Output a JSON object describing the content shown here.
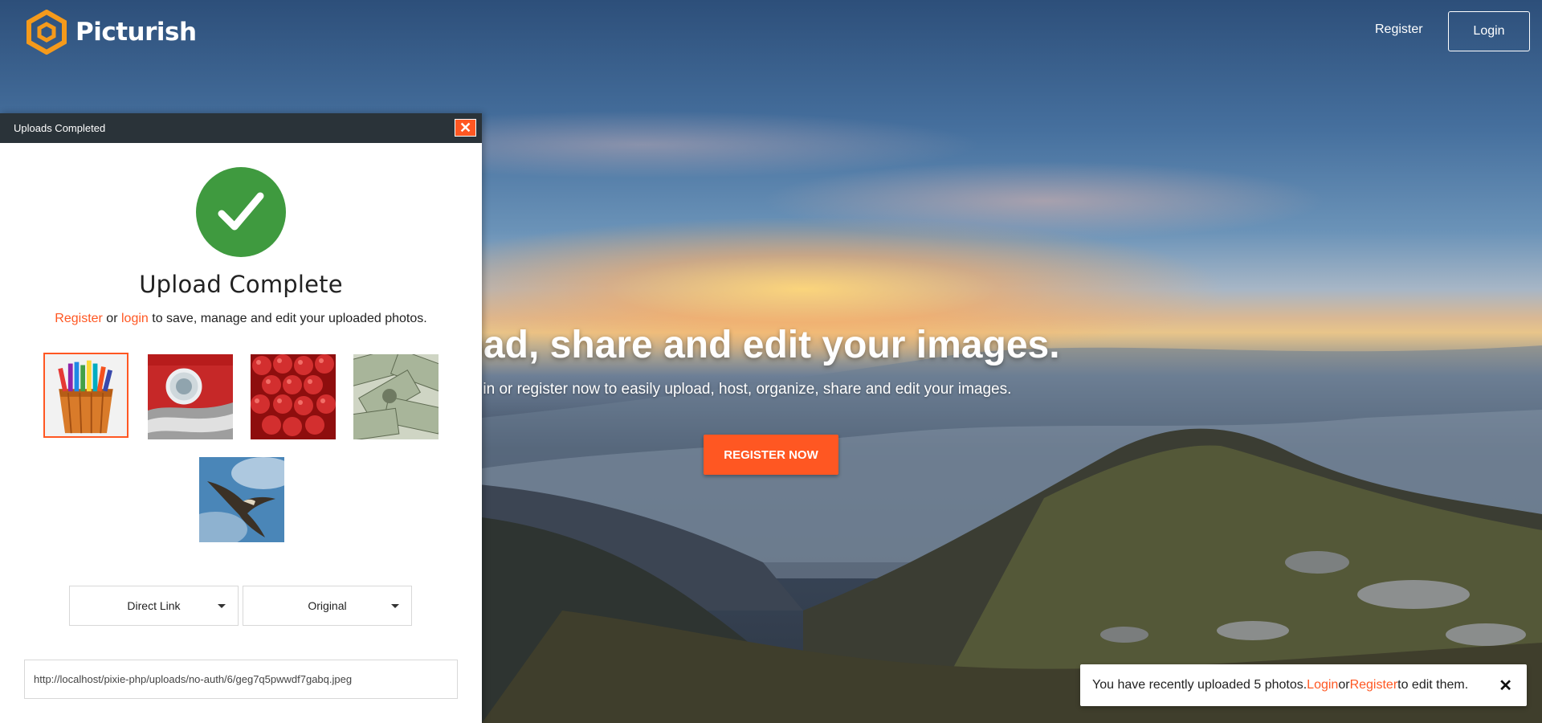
{
  "brand": {
    "name": "Picturish",
    "accent_color": "#ff5722",
    "logo_color": "#f59a1b"
  },
  "header": {
    "register_label": "Register",
    "login_label": "Login"
  },
  "hero": {
    "title": "pload, share and edit your images.",
    "subtitle": "og in or register now to easily upload, host, organize, share and edit your images.",
    "cta_label": "REGISTER NOW"
  },
  "upload_panel": {
    "header_title": "Uploads Completed",
    "close_icon": "close-icon",
    "status_icon": "checkmark-icon",
    "title": "Upload Complete",
    "message": {
      "register_link": "Register",
      "or": " or ",
      "login_link": "login",
      "rest": " to save, manage and edit your uploaded photos."
    },
    "thumbnails": [
      {
        "name": "colored-pencils",
        "selected": true
      },
      {
        "name": "classic-car",
        "selected": false
      },
      {
        "name": "cherries",
        "selected": false
      },
      {
        "name": "dollar-bills",
        "selected": false
      },
      {
        "name": "flying-bird",
        "selected": false
      }
    ],
    "link_type": {
      "selected": "Direct Link"
    },
    "size_type": {
      "selected": "Original"
    },
    "url": "http://localhost/pixie-php/uploads/no-auth/6/geg7q5pwwdf7gabq.jpeg"
  },
  "toast": {
    "text_before": "You have recently uploaded 5 photos. ",
    "login_link": "Login",
    "or": " or ",
    "register_link": "Register",
    "text_after": " to edit them.",
    "close_glyph": "✕"
  }
}
